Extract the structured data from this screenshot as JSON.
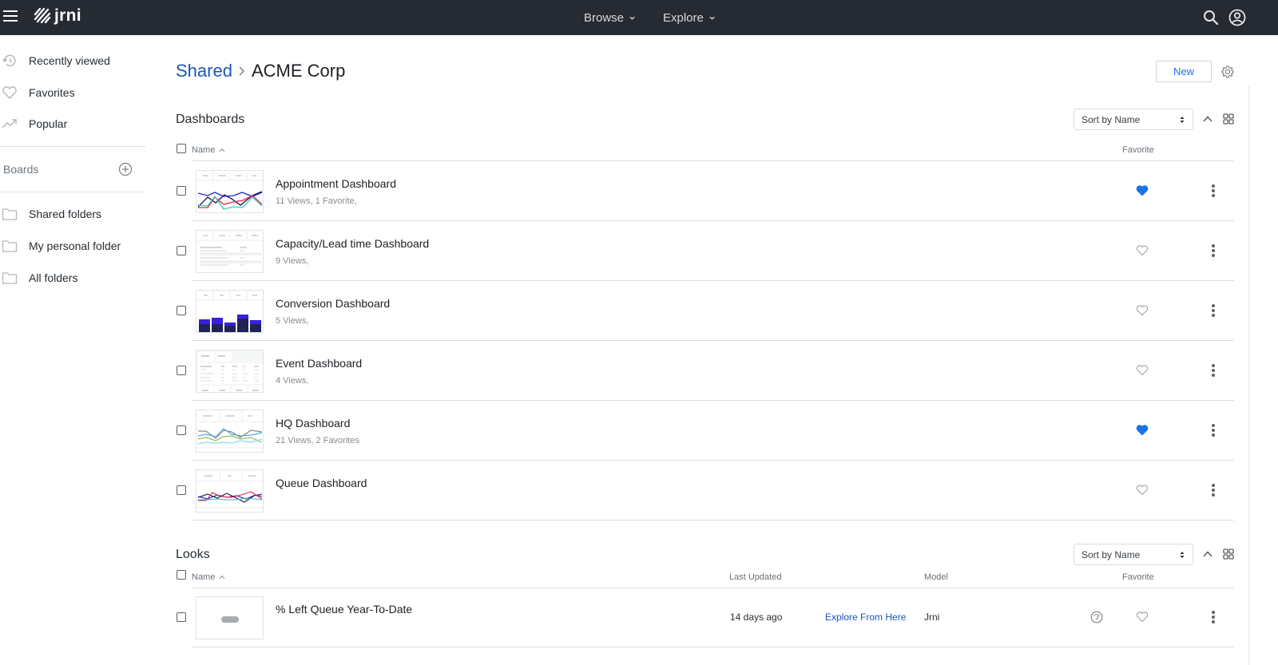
{
  "app": {
    "name": "jrni"
  },
  "topnav": {
    "browse": "Browse",
    "explore": "Explore",
    "icons": [
      "menu-icon",
      "search-icon",
      "account-icon"
    ]
  },
  "sidebar": {
    "items": [
      {
        "label": "Recently viewed",
        "icon": "history-icon"
      },
      {
        "label": "Favorites",
        "icon": "heart-icon"
      },
      {
        "label": "Popular",
        "icon": "trending-icon"
      }
    ],
    "boards_label": "Boards",
    "folders": [
      {
        "label": "Shared folders",
        "icon": "folder-icon"
      },
      {
        "label": "My personal folder",
        "icon": "folder-icon"
      },
      {
        "label": "All folders",
        "icon": "folder-icon"
      }
    ]
  },
  "breadcrumb": {
    "parent": "Shared",
    "current": "ACME Corp"
  },
  "actions": {
    "new_label": "New"
  },
  "dashboards": {
    "title": "Dashboards",
    "sort": "Sort by Name",
    "columns": {
      "name": "Name",
      "favorite": "Favorite"
    },
    "items": [
      {
        "title": "Appointment Dashboard",
        "stats": "11 Views, 1 Favorite,",
        "favorited": true,
        "thumb": "line-multi"
      },
      {
        "title": "Capacity/Lead time Dashboard",
        "stats": "9 Views,",
        "favorited": false,
        "thumb": "table"
      },
      {
        "title": "Conversion Dashboard",
        "stats": "5 Views,",
        "favorited": false,
        "thumb": "bar"
      },
      {
        "title": "Event Dashboard",
        "stats": "4 Views,",
        "favorited": false,
        "thumb": "table-grid"
      },
      {
        "title": "HQ Dashboard",
        "stats": "21 Views, 2 Favorites",
        "favorited": true,
        "thumb": "line-soft"
      },
      {
        "title": "Queue Dashboard",
        "stats": "",
        "favorited": false,
        "thumb": "line-queue"
      }
    ]
  },
  "looks": {
    "title": "Looks",
    "sort": "Sort by Name",
    "columns": {
      "name": "Name",
      "last_updated": "Last Updated",
      "model": "Model",
      "favorite": "Favorite"
    },
    "items": [
      {
        "title": "% Left Queue Year-To-Date",
        "last_updated": "14 days ago",
        "explore_link": "Explore From Here",
        "model": "Jrni",
        "favorited": false
      }
    ]
  },
  "colors": {
    "topbar": "#262a33",
    "link": "#1a56b8",
    "favorite": "#1a73e8"
  }
}
